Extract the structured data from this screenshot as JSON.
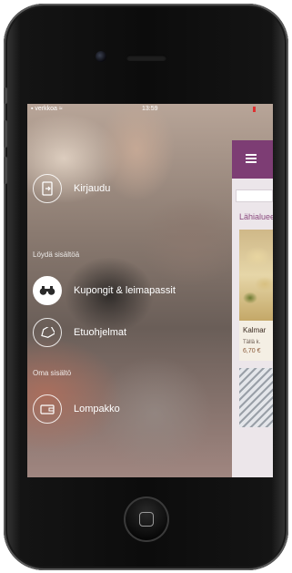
{
  "status_bar": {
    "carrier": "▪ verkkoa ≈",
    "time": "13:59"
  },
  "menu": {
    "login": {
      "label": "Kirjaudu",
      "icon": "login-door-icon"
    },
    "section_find": "Löydä sisältöä",
    "items": [
      {
        "label": "Kupongit & leimapassit",
        "icon": "binoculars-icon",
        "active": true
      },
      {
        "label": "Etuohjelmat",
        "icon": "tag-icon",
        "active": false
      }
    ],
    "section_own": "Oma sisältö",
    "wallet": {
      "label": "Lompakko",
      "icon": "wallet-icon"
    }
  },
  "app_preview": {
    "header_color": "#7d3d74",
    "section_title": "Lähialueen",
    "card": {
      "name": "Kalmar",
      "sub": "Tällä k.",
      "price": "6,70 €"
    }
  }
}
